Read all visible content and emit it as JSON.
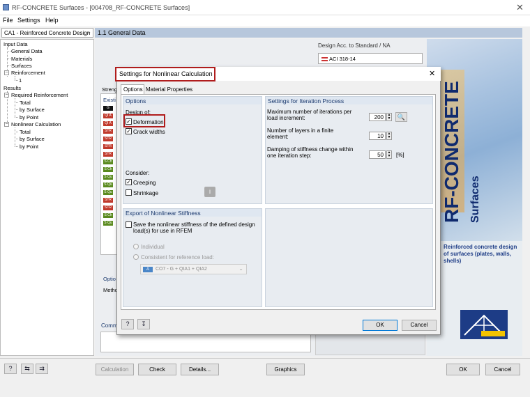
{
  "window": {
    "title": "RF-CONCRETE Surfaces - [004708_RF-CONCRETE Surfaces]"
  },
  "menu": [
    "File",
    "Settings",
    "Help"
  ],
  "case_combo": "CA1 - Reinforced Concrete Design",
  "tree": {
    "input_data": "Input Data",
    "general_data": "General Data",
    "materials": "Materials",
    "surfaces": "Surfaces",
    "reinforcement": "Reinforcement",
    "reinf_1": "1",
    "results": "Results",
    "required_reinforcement": "Required Reinforcement",
    "total": "Total",
    "by_surface": "by Surface",
    "by_point": "by Point",
    "nonlinear_calculation": "Nonlinear Calculation",
    "nl_total": "Total",
    "nl_by_surface": "by Surface",
    "nl_by_point": "by Point"
  },
  "main_header": "1.1 General Data",
  "standard": {
    "label": "Design Acc. to Standard / NA",
    "value": "ACI 318-14"
  },
  "brand": {
    "title": "RF-CONCRETE",
    "subtitle": "Surfaces",
    "description": "Reinforced concrete design of surfaces (plates, walls, shells)"
  },
  "background_labels": {
    "tab": "Streng",
    "existing": "Existi",
    "options": "Optio",
    "method": "Metho",
    "comment": "Comm"
  },
  "tags": [
    "G",
    "QI A",
    "QI A",
    "STR",
    "STR",
    "STR",
    "STR",
    "S Ch",
    "S Ch",
    "S Qu",
    "S Qu",
    "S Qu",
    "STR",
    "STR",
    "S Ch",
    "S Qu"
  ],
  "bottom_buttons": {
    "calculation": "Calculation",
    "check": "Check",
    "details": "Details...",
    "graphics": "Graphics",
    "ok": "OK",
    "cancel": "Cancel"
  },
  "dialog": {
    "title": "Settings for Nonlinear Calculation",
    "tabs": [
      "Options",
      "Material Properties"
    ],
    "options": {
      "header": "Options",
      "design_of": "Design of:",
      "deformation": "Deformation",
      "crack_widths": "Crack widths",
      "consider": "Consider:",
      "creeping": "Creeping",
      "shrinkage": "Shrinkage"
    },
    "iteration": {
      "header": "Settings for Iteration Process",
      "max_iter_label": "Maximum number of iterations per load increment:",
      "max_iter": "200",
      "layers_label": "Number of layers in a finite element:",
      "layers": "10",
      "damping_label": "Damping of stiffness change within one iteration step:",
      "damping": "50",
      "damping_unit": "[%]"
    },
    "export": {
      "header": "Export of Nonlinear Stiffness",
      "save_label": "Save the nonlinear stiffness of the defined design load(s) for use in RFEM",
      "individual": "Individual",
      "consistent": "Consistent for reference load:",
      "load_badge": "A",
      "load_value": "CO7 - G + QIA1 + QIA2"
    },
    "ok": "OK",
    "cancel": "Cancel"
  }
}
